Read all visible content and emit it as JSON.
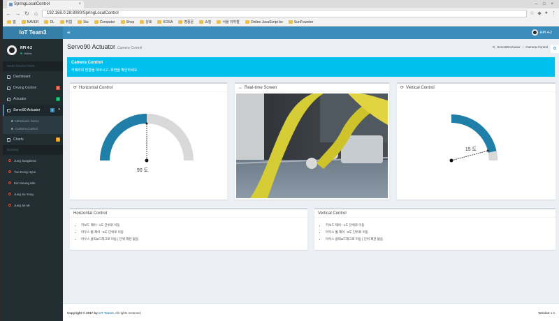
{
  "browser": {
    "tab_title": "SpringLocalControl",
    "url": "192.168.0.28:8080/SpringLocalControl",
    "bookmarks": [
      "앱",
      "NAVER",
      "DL",
      "취업",
      "Stu",
      "Computer",
      "Shop",
      "성호",
      "KOSA",
      "영풍문",
      "쇼핑",
      "서울 지하철",
      "Online JavaScript be",
      "SunFounder"
    ]
  },
  "app": {
    "logo": "IoT Team3",
    "user_name": "RPI 4-2",
    "user_status": "Online",
    "nav_user": "RPI 4-2",
    "section_main": "MAIN NAVIGATION",
    "menu": [
      {
        "label": "Dashboard"
      },
      {
        "label": "Driving Control",
        "badge": "8",
        "badge_color": "#dd4b39"
      },
      {
        "label": "Actuator",
        "badge": "3",
        "badge_color": "#00a65a"
      },
      {
        "label": "Servo90 Actuator",
        "badge": "4",
        "badge_color": "#3c8dbc",
        "active": true
      },
      {
        "label": "Charts",
        "badge": "5",
        "badge_color": "#f39c12"
      }
    ],
    "submenu": [
      "UltraSonic Servo",
      "Camera Control"
    ],
    "section_labels": "Develop",
    "labels": [
      "Jung SungSeon",
      "Yoo Dong Hyun",
      "Kim Seung Min",
      "Jung Su Yong",
      "Jung Se Mi"
    ]
  },
  "page": {
    "title": "Servo90 Actuator",
    "subtitle": "Camera Control",
    "breadcrumb": [
      "Servo90Actuator",
      "Camera Control"
    ],
    "callout_title": "Camera Control",
    "callout_text": "카메라의 방향을 바꾸시고, 화면을 확인하세요."
  },
  "panels": {
    "horizontal": {
      "title": "Horizontal Control",
      "angle_label": "90 도",
      "angle": 90
    },
    "stream": {
      "title": "Real-time Screen"
    },
    "vertical": {
      "title": "Vertical Control",
      "angle_label": "15 도",
      "angle": 15
    },
    "h_help": {
      "title": "Horizontal Control",
      "items": [
        "키보드 제어 : 1도 단위로 이동",
        "마우스 휠 제어 : 5도 단위로 이동",
        "마우스 클릭&드래그로 이동 | 단위 제한 없음"
      ]
    },
    "v_help": {
      "title": "Vertical Control",
      "items": [
        "키보드 제어 : 1도 단위로 이동",
        "마우스 휠 제어 : 5도 단위로 이동",
        "마우스 클릭&드래그로 이동 | 단위 제한 없음"
      ]
    }
  },
  "footer": {
    "copyright_prefix": "Copyright © 2017 by",
    "brand": "IoT Team3.",
    "rights": "All rights reserved.",
    "version_label": "Version",
    "version": "1.0"
  },
  "colors": {
    "gauge_fill": "#1f7fa8",
    "gauge_track": "#d9d9d9",
    "primary": "#3c8dbc",
    "info": "#00c0ef"
  }
}
